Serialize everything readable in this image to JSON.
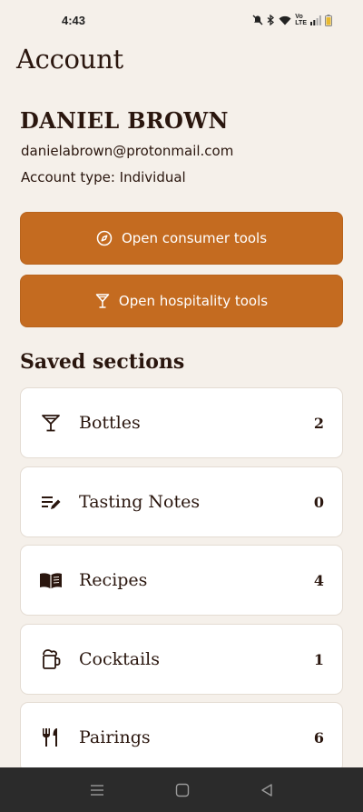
{
  "status": {
    "time": "4:43",
    "icons": [
      "mute-icon",
      "bluetooth-icon",
      "wifi-icon",
      "volte-icon",
      "signal-icon",
      "battery-icon"
    ],
    "volte_label_top": "Vo",
    "volte_label_bottom": "LTE"
  },
  "page": {
    "title": "Account"
  },
  "user": {
    "name": "DANIEL BROWN",
    "email": "danielabrown@protonmail.com",
    "account_type": "Account type: Individual"
  },
  "actions": {
    "consumer_label": "Open consumer tools",
    "hospitality_label": "Open hospitality tools",
    "accent_color": "#c46b20"
  },
  "saved": {
    "heading": "Saved sections",
    "items": [
      {
        "icon": "cocktail-glass-icon",
        "label": "Bottles",
        "count": "2"
      },
      {
        "icon": "notes-edit-icon",
        "label": "Tasting Notes",
        "count": "0"
      },
      {
        "icon": "open-book-icon",
        "label": "Recipes",
        "count": "4"
      },
      {
        "icon": "beer-mug-icon",
        "label": "Cocktails",
        "count": "1"
      },
      {
        "icon": "fork-knife-icon",
        "label": "Pairings",
        "count": "6"
      }
    ]
  },
  "system_nav": {
    "icons": [
      "menu-icon",
      "home-icon",
      "back-icon"
    ]
  }
}
